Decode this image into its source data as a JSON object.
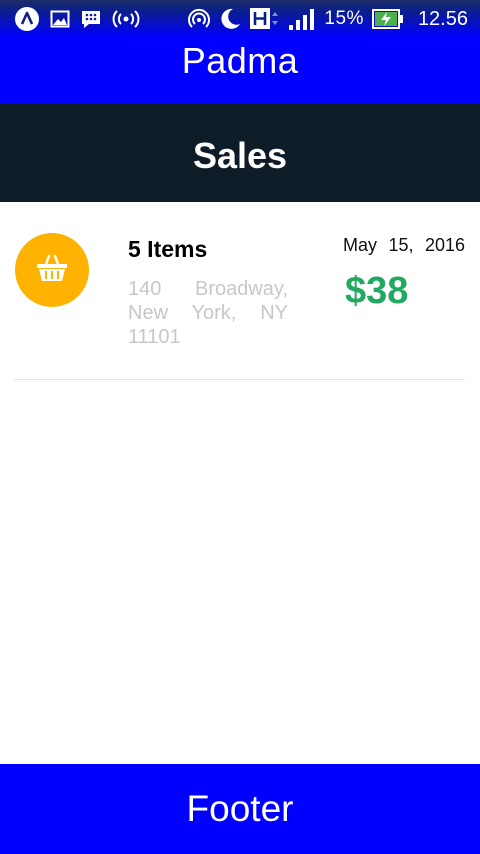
{
  "status_bar": {
    "icons": [
      "app-a-icon",
      "image-icon",
      "blackberry-icon",
      "broadcast-icon",
      "hotspot-icon",
      "moon-icon",
      "h-network-icon",
      "signal-icon",
      "battery-charging-icon"
    ],
    "battery": "15%",
    "time": "12.56"
  },
  "app_bar": {
    "title": "Padma"
  },
  "section": {
    "title": "Sales"
  },
  "sales": [
    {
      "icon": "basket-icon",
      "icon_color": "#ffb300",
      "items": "5 Items",
      "address": "140 Broadway, New York, NY 11101",
      "date": "May 15, 2016",
      "amount": "$38",
      "amount_color": "#22a961"
    }
  ],
  "footer": {
    "label": "Footer"
  },
  "colors": {
    "primary": "#0000ff",
    "header_dark": "#0e1c28"
  }
}
